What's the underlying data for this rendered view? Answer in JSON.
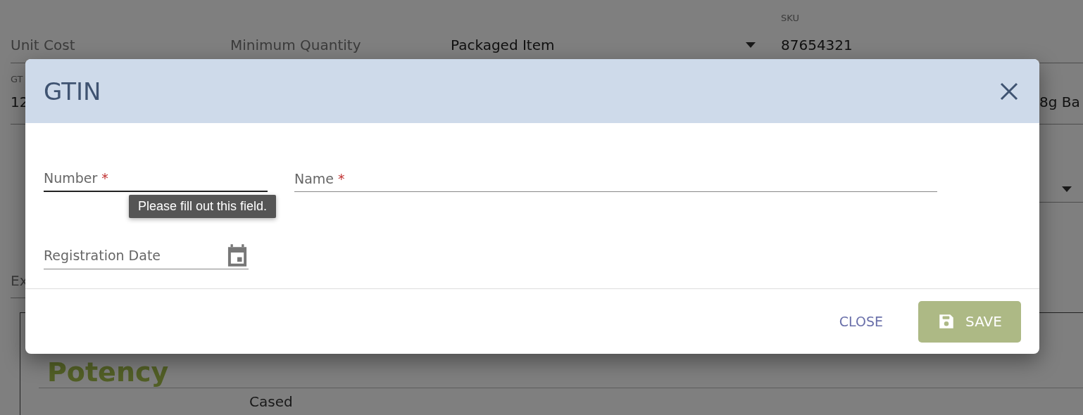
{
  "background": {
    "row_1": [
      {
        "kind": "placeholder",
        "text": "Unit Cost"
      },
      {
        "kind": "placeholder",
        "text": "Minimum Quantity"
      },
      {
        "kind": "select",
        "value": "Packaged Item"
      },
      {
        "kind": "filled",
        "label": "SKU",
        "value": "87654321"
      }
    ],
    "row_2": [
      {
        "label": "GT",
        "value": "12"
      },
      {
        "value": "8g Ba"
      }
    ],
    "row_4": {
      "text": "Ex"
    },
    "panel": {
      "title": "Potency",
      "cell": "Cased"
    }
  },
  "dialog": {
    "title": "GTIN",
    "fields": [
      {
        "label": "Number",
        "required_mark": "*",
        "focused": true
      },
      {
        "label": "Name",
        "required_mark": "*",
        "focused": false
      }
    ],
    "tooltip": "Please fill out this field.",
    "date_field": {
      "label": "Registration Date"
    },
    "buttons": [
      {
        "kind": "text",
        "label": "CLOSE"
      },
      {
        "kind": "primary",
        "label": "SAVE"
      }
    ]
  }
}
